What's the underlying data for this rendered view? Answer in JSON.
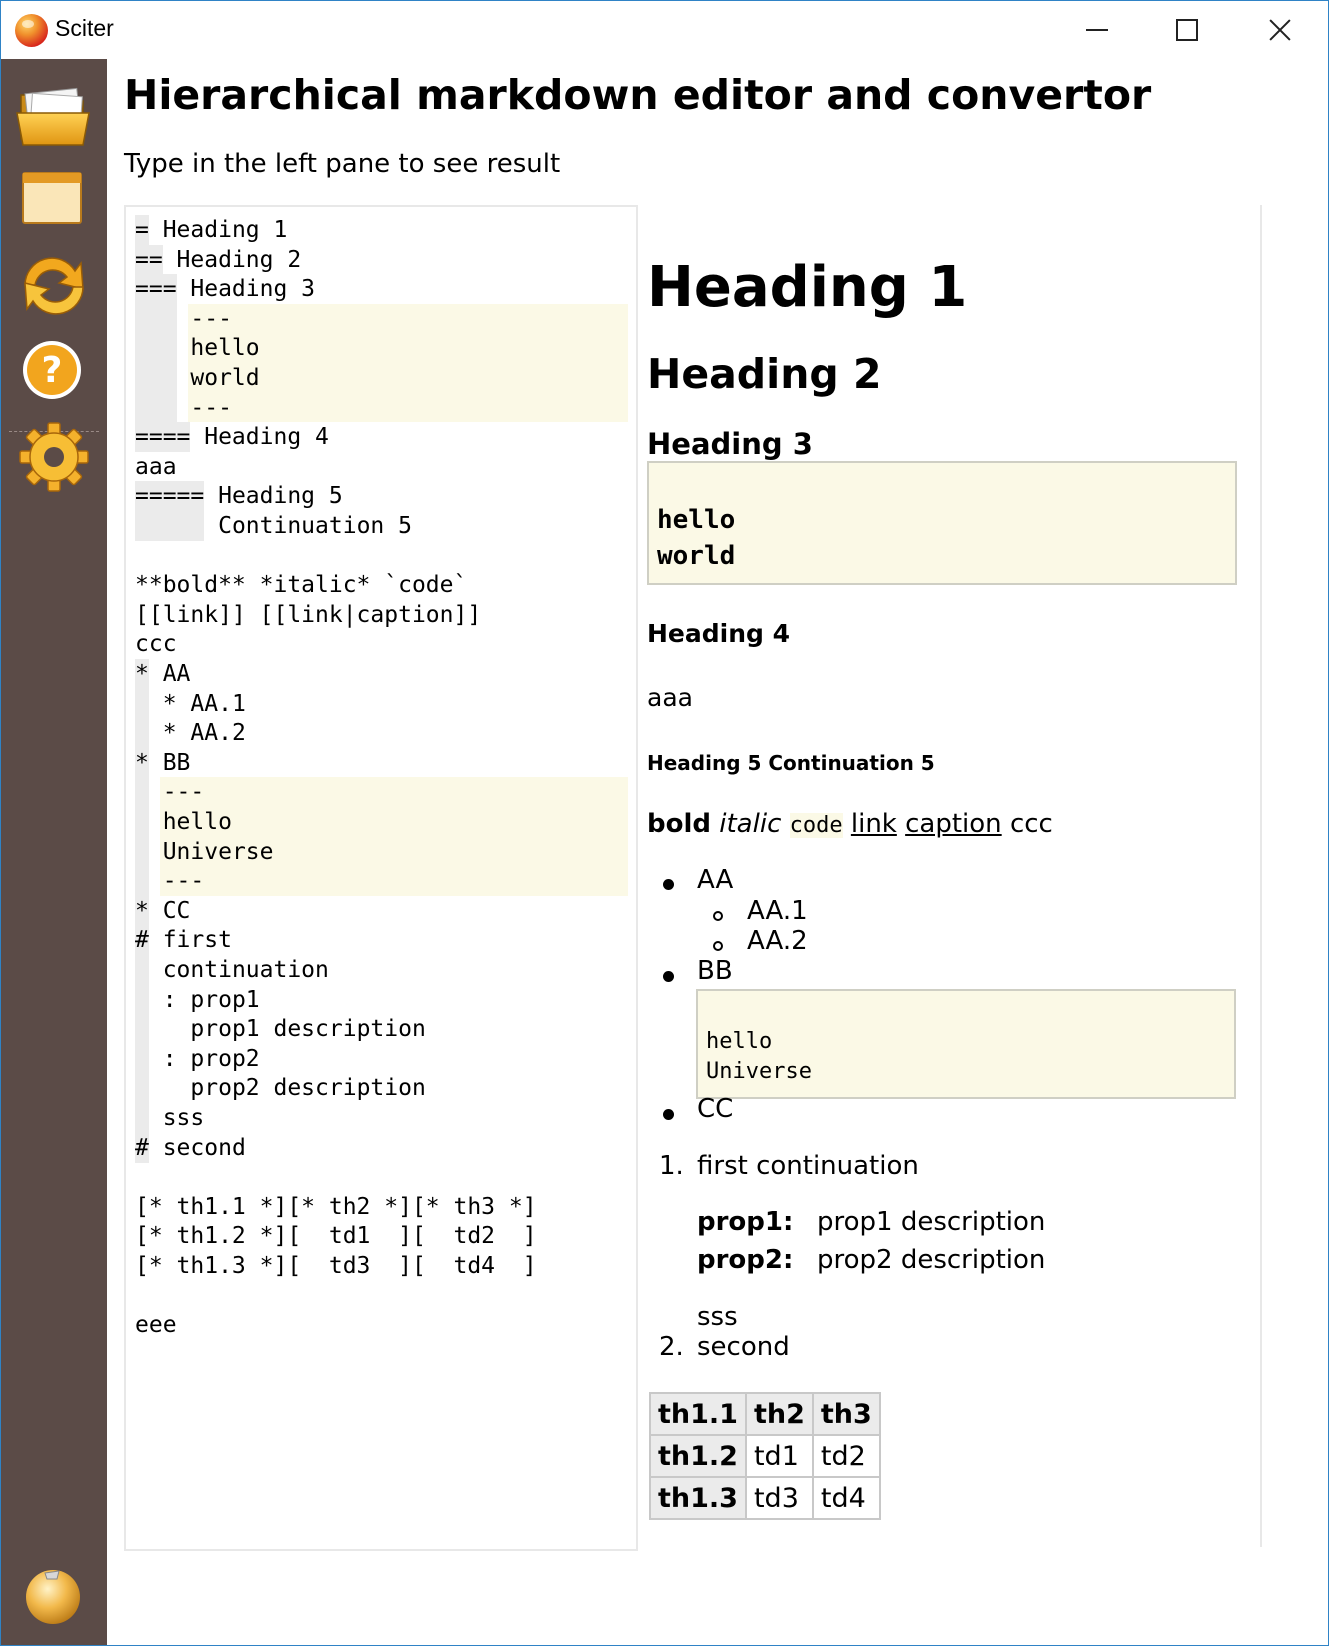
{
  "window": {
    "title": "Sciter",
    "controls": [
      "minimize",
      "maximize",
      "close"
    ]
  },
  "sidebar": {
    "icons": [
      "folder-open-icon",
      "window-icon",
      "refresh-icon",
      "help-icon",
      "gear-icon",
      "orb-icon"
    ]
  },
  "page": {
    "title": "Hierarchical markdown editor and convertor",
    "subtitle": "Type in the left pane to see result"
  },
  "editor": {
    "lines": [
      {
        "marker": "=",
        "text": " Heading 1"
      },
      {
        "marker": "==",
        "text": " Heading 2"
      },
      {
        "marker": "===",
        "text": " Heading 3"
      },
      {
        "marker": "   ",
        "text": " ---"
      },
      {
        "marker": "   ",
        "text": " hello"
      },
      {
        "marker": "   ",
        "text": " world"
      },
      {
        "marker": "   ",
        "text": " ---"
      },
      {
        "marker": "====",
        "text": " Heading 4"
      },
      {
        "marker": "",
        "text": "aaa"
      },
      {
        "marker": "=====",
        "text": " Heading 5"
      },
      {
        "marker": "     ",
        "text": " Continuation 5"
      },
      {
        "marker": "",
        "text": ""
      },
      {
        "marker": "",
        "text": "**bold** *italic* `code`"
      },
      {
        "marker": "",
        "text": "[[link]] [[link|caption]]"
      },
      {
        "marker": "",
        "text": "ccc"
      },
      {
        "marker": "*",
        "text": " AA"
      },
      {
        "marker": " ",
        "text": " * AA.1"
      },
      {
        "marker": " ",
        "text": " * AA.2"
      },
      {
        "marker": "*",
        "text": " BB"
      },
      {
        "marker": " ",
        "text": " ---"
      },
      {
        "marker": " ",
        "text": " hello"
      },
      {
        "marker": " ",
        "text": " Universe"
      },
      {
        "marker": " ",
        "text": " ---"
      },
      {
        "marker": "*",
        "text": " CC"
      },
      {
        "marker": "#",
        "text": " first"
      },
      {
        "marker": " ",
        "text": " continuation"
      },
      {
        "marker": " ",
        "text": " : prop1"
      },
      {
        "marker": " ",
        "text": "   prop1 description"
      },
      {
        "marker": " ",
        "text": " : prop2"
      },
      {
        "marker": " ",
        "text": "   prop2 description"
      },
      {
        "marker": " ",
        "text": " sss"
      },
      {
        "marker": "#",
        "text": " second"
      },
      {
        "marker": "",
        "text": ""
      },
      {
        "marker": "",
        "text": "[* th1.1 *][* th2 *][* th3 *]"
      },
      {
        "marker": "",
        "text": "[* th1.2 *][  td1  ][  td2  ]"
      },
      {
        "marker": "",
        "text": "[* th1.3 *][  td3  ][  td4  ]"
      },
      {
        "marker": "",
        "text": ""
      },
      {
        "marker": "",
        "text": "eee"
      }
    ]
  },
  "preview": {
    "h1": "Heading 1",
    "h2": "Heading 2",
    "h3": "Heading 3",
    "pre1": [
      "hello",
      "world"
    ],
    "h4": "Heading 4",
    "para_aaa": "aaa",
    "h5": "Heading 5 Continuation 5",
    "inline": {
      "bold": "bold",
      "italic": "italic",
      "code": "code",
      "link": "link",
      "caption": "caption",
      "tail": "ccc"
    },
    "list": {
      "aa": "AA",
      "aa1": "AA.1",
      "aa2": "AA.2",
      "bb": "BB",
      "pre2": [
        "hello",
        "Universe"
      ],
      "cc": "CC"
    },
    "olist": {
      "n1": "1.",
      "first": "first continuation",
      "prop1_term": "prop1:",
      "prop1_desc": "prop1 description",
      "prop2_term": "prop2:",
      "prop2_desc": "prop2 description",
      "sss": "sss",
      "n2": "2.",
      "second": "second"
    },
    "table": {
      "rows": [
        [
          "th1.1",
          "th2",
          "th3"
        ],
        [
          "th1.2",
          "td1",
          "td2"
        ],
        [
          "th1.3",
          "td3",
          "td4"
        ]
      ]
    }
  },
  "colors": {
    "sidebar": "#5b4b47",
    "code_bg": "#fbf9e6",
    "marker_bg": "#ebebeb",
    "window_border": "#2f83c6"
  }
}
